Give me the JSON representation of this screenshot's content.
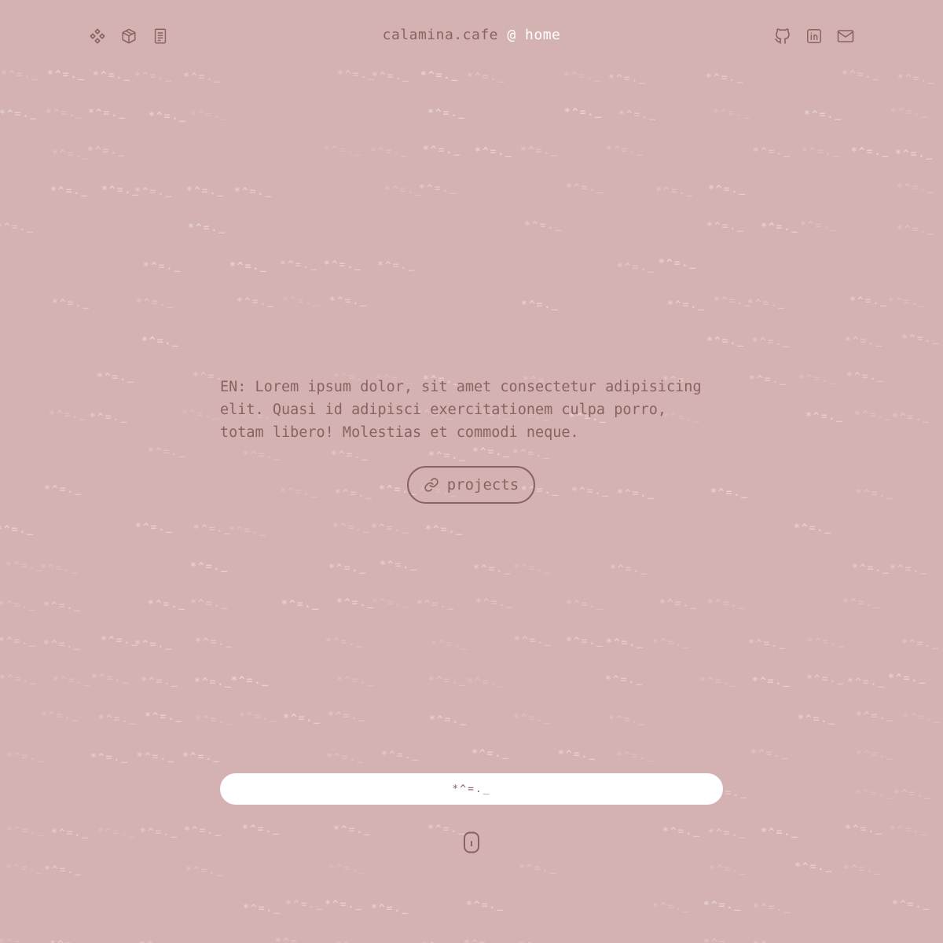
{
  "header": {
    "site_name": "calamina.cafe",
    "at_symbol": "@",
    "current_page": "home",
    "left_icons": [
      "diamonds-icon",
      "cube-icon",
      "document-icon"
    ],
    "right_icons": [
      "github-icon",
      "linkedin-icon",
      "mail-icon"
    ]
  },
  "main": {
    "intro_text": "EN: Lorem ipsum dolor, sit amet consectetur adipisicing elit. Quasi id adipisci exercitationem culpa porro, totam libero! Molestias et commodi neque.",
    "projects_button": {
      "label": "projects",
      "icon": "link-icon"
    }
  },
  "footer": {
    "marquee_text": "*^=._",
    "scroll_icon": "mouse-scroll-icon"
  },
  "background": {
    "pattern_text": "*^=._"
  },
  "colors": {
    "background": "#d4b2b1",
    "text": "#8a6262",
    "accent": "#ffffff"
  }
}
